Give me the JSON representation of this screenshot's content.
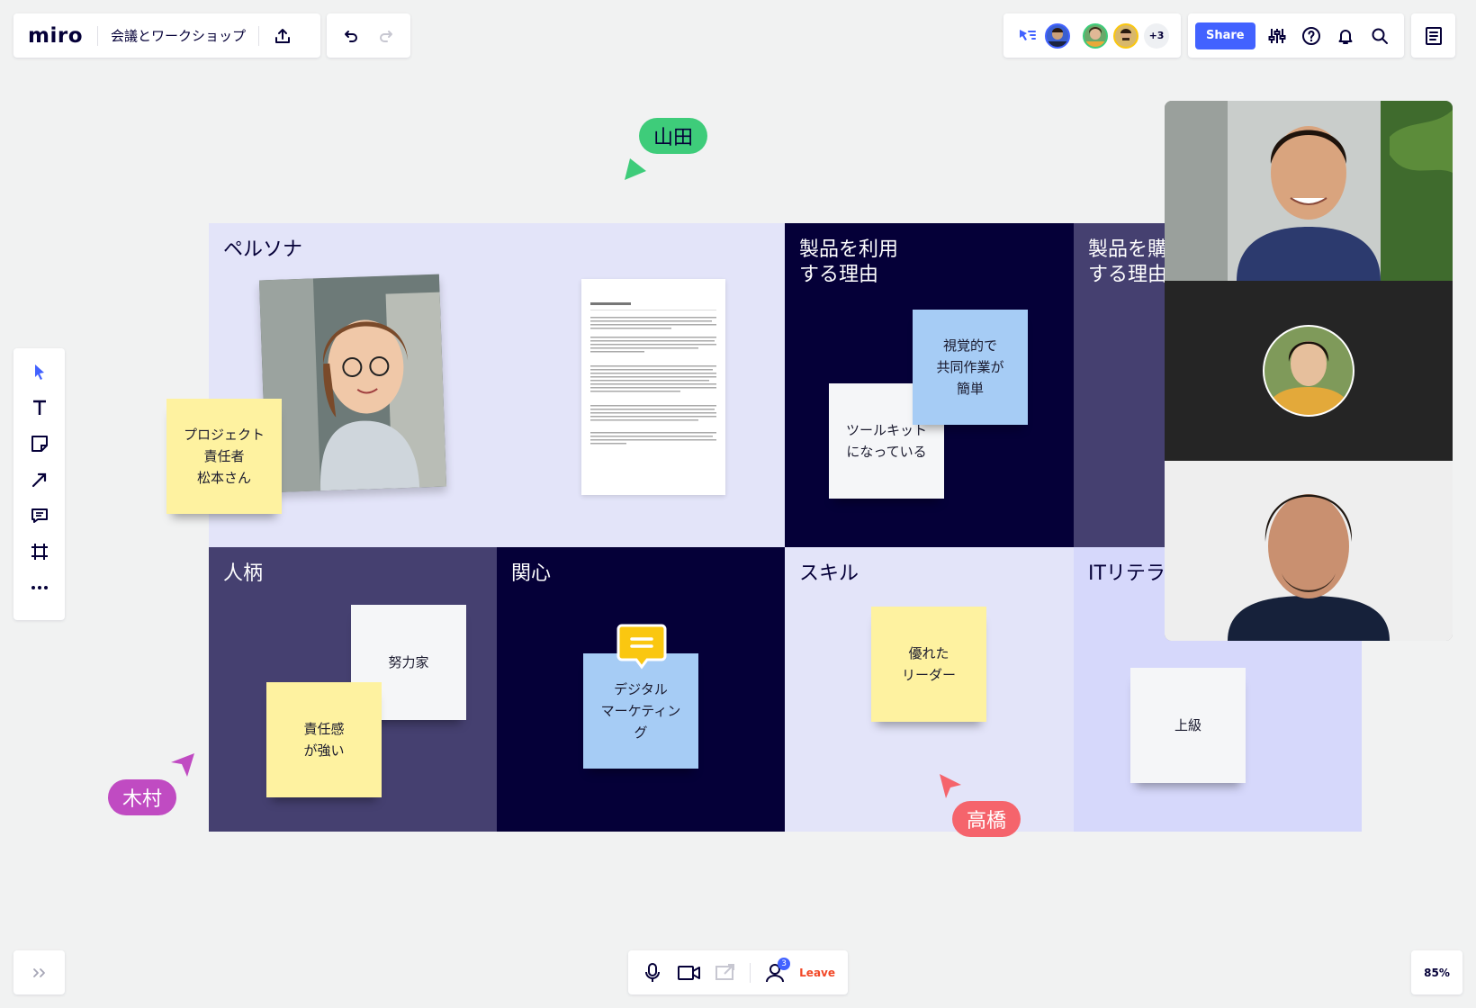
{
  "app": {
    "logo": "miro",
    "board_title": "会議とワークショップ"
  },
  "collab": {
    "extra_count": "+3"
  },
  "toolbar_right": {
    "share_label": "Share"
  },
  "board": {
    "cells": {
      "persona": "ペルソナ",
      "use_reason": "製品を利用\nする理由",
      "buy_reason": "製品を購入\nする理由",
      "personality": "人柄",
      "interest": "関心",
      "skill": "スキル",
      "it_literacy": "ITリテラシー"
    },
    "stickies": {
      "project_lead": "プロジェクト\n責任者\n松本さん",
      "visual": "視覚的で\n共同作業が\n簡単",
      "toolkit": "ツールキット\nになっている",
      "hardworker": "努力家",
      "responsible": "責任感\nが強い",
      "digital": "デジタル\nマーケティン\nグ",
      "leader": "優れた\nリーダー",
      "advanced": "上級"
    }
  },
  "cursors": {
    "yamada": "山田",
    "kimura": "木村",
    "takahashi": "高橋"
  },
  "call": {
    "participants_badge": "3",
    "leave_label": "Leave"
  },
  "zoom": {
    "level": "85%"
  },
  "colors": {
    "accent": "#4262ff",
    "cursor_yamada": "#3ecc7a",
    "cursor_kimura": "#c04bc2",
    "cursor_takahashi": "#f5646c"
  }
}
